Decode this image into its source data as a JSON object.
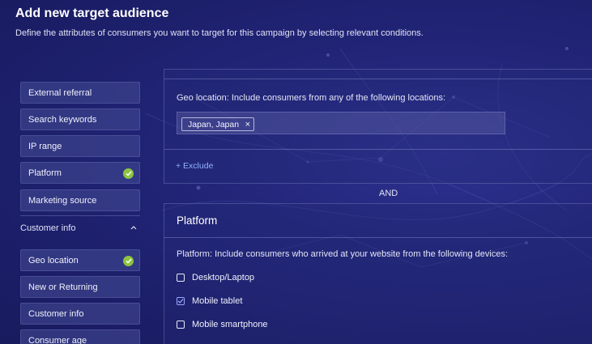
{
  "header": {
    "title": "Add new target audience",
    "subtitle": "Define the attributes of consumers you want to target for this campaign by selecting relevant conditions."
  },
  "sidebar": {
    "items_top": [
      {
        "label": "External referral",
        "checked": false
      },
      {
        "label": "Search keywords",
        "checked": false
      },
      {
        "label": "IP range",
        "checked": false
      },
      {
        "label": "Platform",
        "checked": true
      },
      {
        "label": "Marketing source",
        "checked": false
      }
    ],
    "section": {
      "label": "Customer info",
      "expanded": true
    },
    "items_section": [
      {
        "label": "Geo location",
        "checked": true
      },
      {
        "label": "New or Returning",
        "checked": false
      },
      {
        "label": "Customer info",
        "checked": false
      },
      {
        "label": "Consumer age",
        "checked": false
      }
    ]
  },
  "geo": {
    "label": "Geo location: Include consumers from any of the following locations:",
    "chips": [
      "Japan, Japan"
    ],
    "chip_remove": "×",
    "exclude_link": "+ Exclude"
  },
  "connector": "AND",
  "platform": {
    "title": "Platform",
    "label": "Platform: Include consumers who arrived at your website from the following devices:",
    "options": [
      {
        "label": "Desktop/Laptop",
        "checked": false
      },
      {
        "label": "Mobile tablet",
        "checked": true
      },
      {
        "label": "Mobile smartphone",
        "checked": false
      }
    ]
  },
  "colors": {
    "background": "#23267a",
    "check_badge": "#8bc53f",
    "link": "#8fb4ff"
  }
}
